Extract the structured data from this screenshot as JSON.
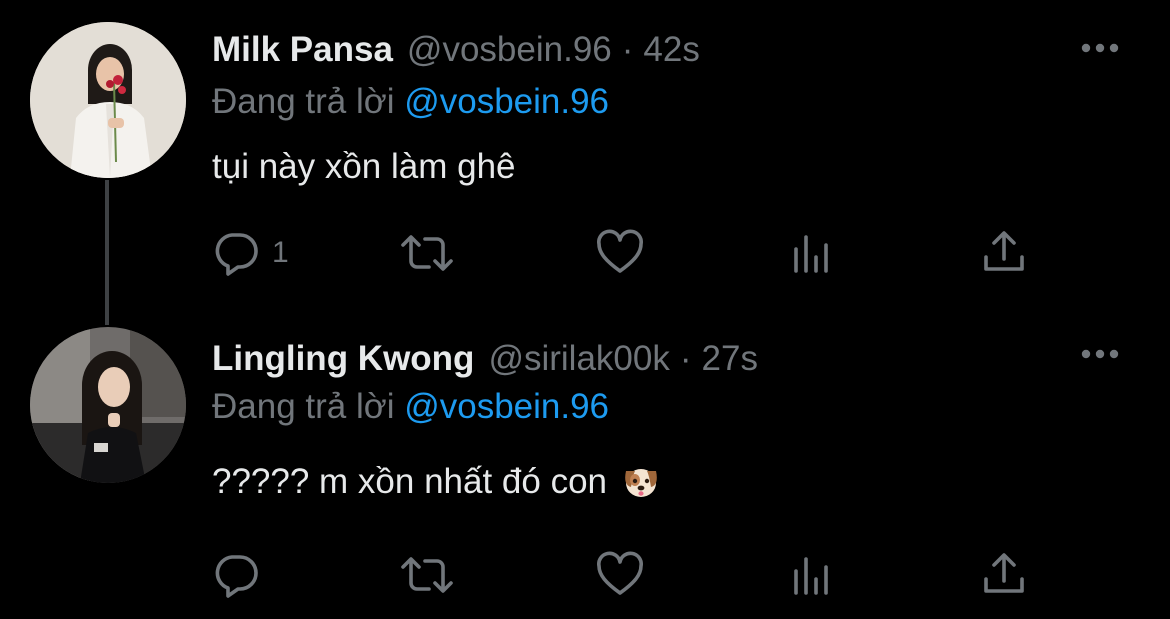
{
  "colors": {
    "background": "#000000",
    "primary_text": "#e7e9ea",
    "secondary_text": "#71767b",
    "link": "#1d9bf0",
    "thread_line": "#3e4144"
  },
  "tweets": [
    {
      "display_name": "Milk Pansa",
      "handle": "@vosbein.96",
      "separator": "·",
      "time": "42s",
      "reply_prefix": "Đang trả lời",
      "reply_to": "@vosbein.96",
      "text": "tụi này xồn làm ghê",
      "emoji": "",
      "reply_count": "1",
      "icons": [
        "reply-icon",
        "retweet-icon",
        "like-icon",
        "analytics-icon",
        "share-icon",
        "more-icon"
      ]
    },
    {
      "display_name": "Lingling Kwong",
      "handle": "@sirilak00k",
      "separator": "·",
      "time": "27s",
      "reply_prefix": "Đang trả lời",
      "reply_to": "@vosbein.96",
      "text": "????? m xồn nhất đó con",
      "emoji": "dog-face-emoji",
      "reply_count": "",
      "icons": [
        "reply-icon",
        "retweet-icon",
        "like-icon",
        "analytics-icon",
        "share-icon",
        "more-icon"
      ]
    }
  ]
}
